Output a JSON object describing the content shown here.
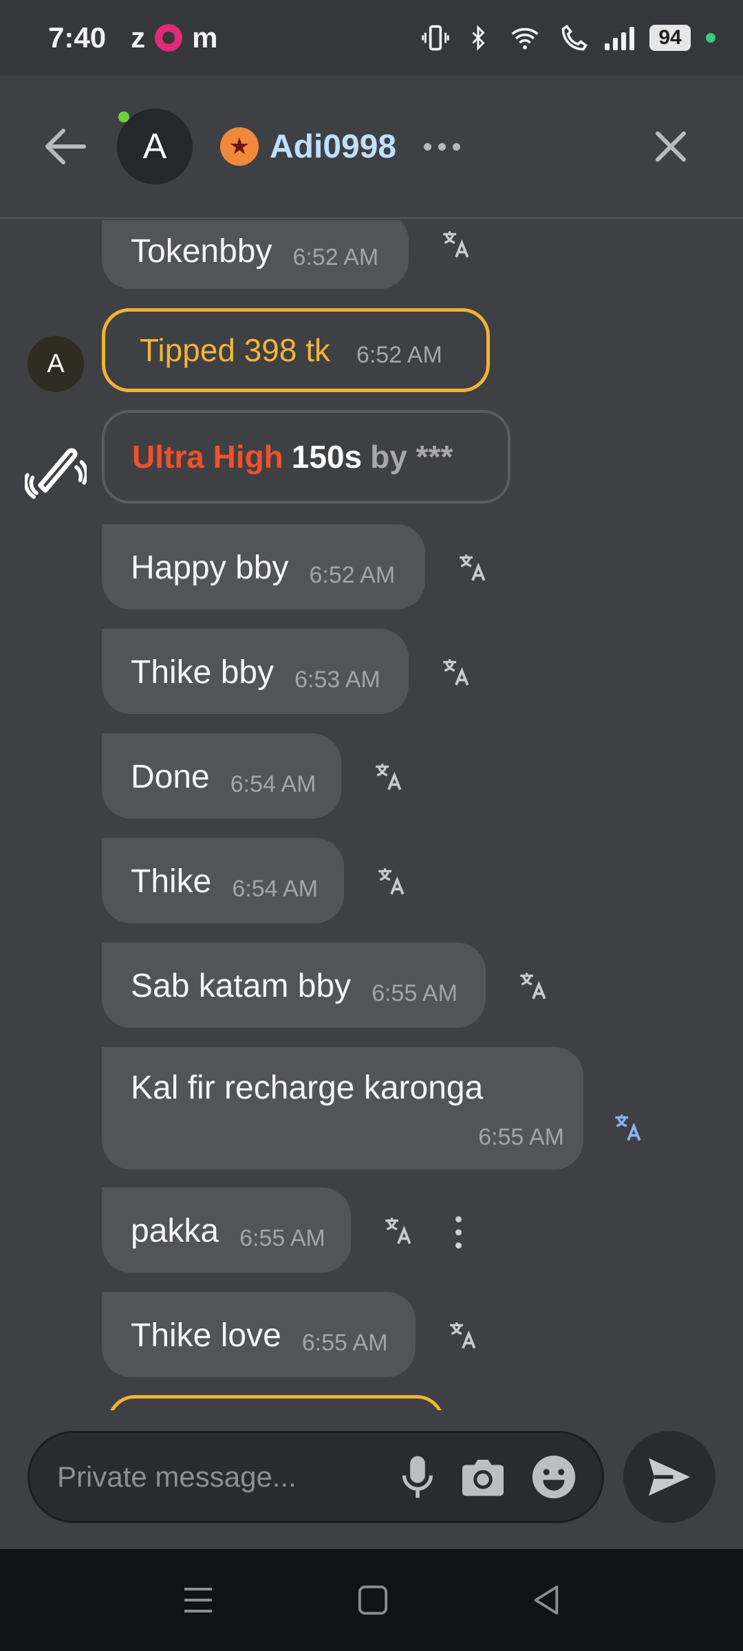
{
  "status_bar": {
    "time": "7:40",
    "app_letters": [
      "z",
      "m"
    ],
    "battery": "94"
  },
  "header": {
    "avatar_letter": "A",
    "username": "Adi0998"
  },
  "messages": [
    {
      "text": "Tokenbby",
      "time": "6:52 AM"
    },
    {
      "text": "Happy bby",
      "time": "6:52 AM"
    },
    {
      "text": "Thike bby",
      "time": "6:53 AM"
    },
    {
      "text": "Done",
      "time": "6:54 AM"
    },
    {
      "text": "Thike",
      "time": "6:54 AM"
    },
    {
      "text": "Sab katam bby",
      "time": "6:55 AM"
    },
    {
      "text": "Kal fir recharge karonga",
      "time": "6:55 AM"
    },
    {
      "text": "pakka",
      "time": "6:55 AM"
    },
    {
      "text": "Thike love",
      "time": "6:55 AM"
    }
  ],
  "tip": {
    "text": "Tipped 398 tk",
    "time": "6:52 AM",
    "sender_letter": "A"
  },
  "vibe": {
    "level": "Ultra High",
    "duration": "150s",
    "by": "by ***"
  },
  "composer": {
    "placeholder": "Private message..."
  },
  "colors": {
    "background": "#3f4044",
    "bubble": "#535458",
    "tip_border": "#f1b431",
    "username": "#bfe0ff",
    "vibe_level": "#f1502a",
    "translate_active": "#8ab4f8"
  }
}
